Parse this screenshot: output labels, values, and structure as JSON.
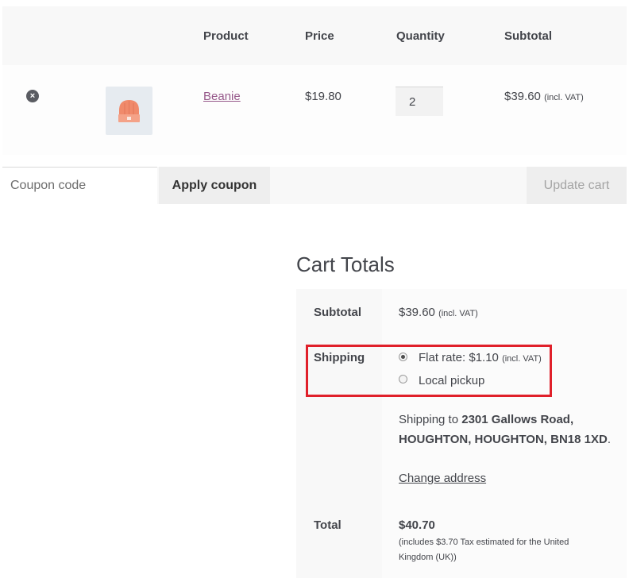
{
  "cart_table": {
    "headers": {
      "product": "Product",
      "price": "Price",
      "quantity": "Quantity",
      "subtotal": "Subtotal"
    },
    "items": [
      {
        "remove_symbol": "×",
        "product_name": "Beanie",
        "price": "$19.80",
        "quantity": "2",
        "subtotal": "$39.60",
        "subtotal_suffix": "(incl. VAT)"
      }
    ]
  },
  "actions": {
    "coupon_placeholder": "Coupon code",
    "apply_coupon_label": "Apply coupon",
    "update_cart_label": "Update cart"
  },
  "cart_totals": {
    "title": "Cart Totals",
    "subtotal_label": "Subtotal",
    "subtotal_value": "$39.60",
    "subtotal_suffix": "(incl. VAT)",
    "shipping_label": "Shipping",
    "shipping_options": [
      {
        "label": "Flat rate: $1.10",
        "suffix": "(incl. VAT)",
        "selected": true
      },
      {
        "label": "Local pickup",
        "suffix": "",
        "selected": false
      }
    ],
    "shipping_to_prefix": "Shipping to",
    "shipping_address_line1": "2301 Gallows Road,",
    "shipping_address_line2": "HOUGHTON, HOUGHTON, BN18 1XD",
    "shipping_address_period": ".",
    "change_address_label": "Change address",
    "total_label": "Total",
    "total_value": "$40.70",
    "tax_note_line1": "(includes $3.70 Tax estimated for the United",
    "tax_note_line2": "Kingdom (UK))"
  },
  "colors": {
    "link": "#96588a",
    "highlight_border": "#e0202a",
    "thumbnail_bg": "#e6ebf0",
    "beanie": "#f08a6b"
  },
  "icons": {
    "remove": "remove-item-icon",
    "product_image": "beanie-icon"
  }
}
